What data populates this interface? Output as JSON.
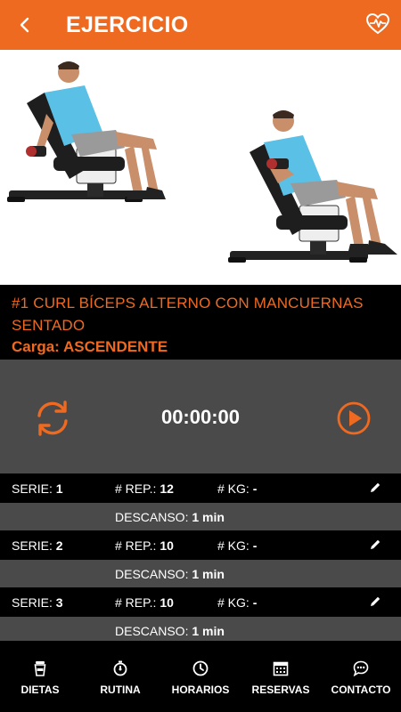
{
  "header": {
    "title": "EJERCICIO",
    "back_icon": "back-arrow-icon",
    "favorite_icon": "heart-pulse-icon"
  },
  "exercise": {
    "name": "#1 CURL BÍCEPS ALTERNO CON MANCUERNAS SENTADO",
    "load_label": "Carga:",
    "load_value": "ASCENDENTE"
  },
  "timer": {
    "value": "00:00:00",
    "reset_icon": "refresh-icon",
    "play_icon": "play-icon"
  },
  "sets": [
    {
      "serie_label": "SERIE:",
      "serie": "1",
      "rep_label": "# REP.:",
      "reps": "12",
      "kg_label": "# KG:",
      "kg": "-",
      "rest_label": "DESCANSO:",
      "rest": "1 min"
    },
    {
      "serie_label": "SERIE:",
      "serie": "2",
      "rep_label": "# REP.:",
      "reps": "10",
      "kg_label": "# KG:",
      "kg": "-",
      "rest_label": "DESCANSO:",
      "rest": "1 min"
    },
    {
      "serie_label": "SERIE:",
      "serie": "3",
      "rep_label": "# REP.:",
      "reps": "10",
      "kg_label": "# KG:",
      "kg": "-",
      "rest_label": "DESCANSO:",
      "rest": "1 min"
    }
  ],
  "bottom_nav": [
    {
      "label": "DIETAS",
      "icon": "cup-icon"
    },
    {
      "label": "RUTINA",
      "icon": "stopwatch-icon"
    },
    {
      "label": "HORARIOS",
      "icon": "clock-icon"
    },
    {
      "label": "RESERVAS",
      "icon": "calendar-icon"
    },
    {
      "label": "CONTACTO",
      "icon": "chat-icon"
    }
  ],
  "colors": {
    "accent": "#ee6a21",
    "panel": "#4a4a4a",
    "background": "#000000"
  }
}
